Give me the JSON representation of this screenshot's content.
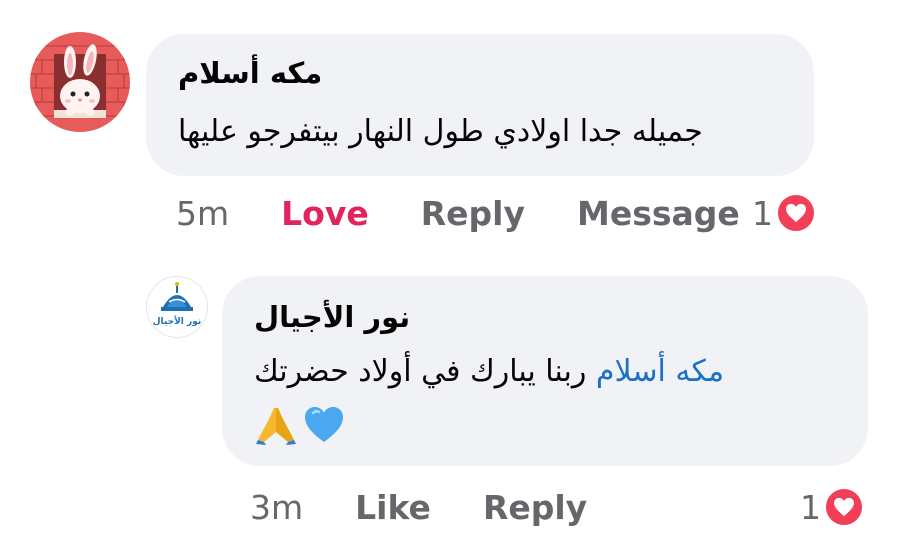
{
  "comments": {
    "main": {
      "author": "مكه أسلام",
      "text": "جميله جدا اولادي طول النهار بيتفرجو عليها",
      "time": "5m",
      "reaction_action": "Love",
      "reply_label": "Reply",
      "message_label": "Message",
      "reaction_count": "1",
      "reaction_icon": "heart-icon"
    },
    "reply": {
      "author": "نور الأجيال",
      "mention": "مكه أسلام",
      "text": "ربنا يبارك في أولاد حضرتك",
      "emojis": [
        "blue-heart-icon",
        "folded-hands-icon"
      ],
      "avatar_logo_text": "نور الأجيال",
      "time": "3m",
      "like_label": "Like",
      "reply_label": "Reply",
      "reaction_count": "1",
      "reaction_icon": "heart-icon"
    }
  },
  "colors": {
    "love": "#e0245e",
    "mention": "#1e6fc7",
    "bubble": "#f0f2f5",
    "heart_badge": "#f33e58",
    "meta_text": "#65676b"
  }
}
